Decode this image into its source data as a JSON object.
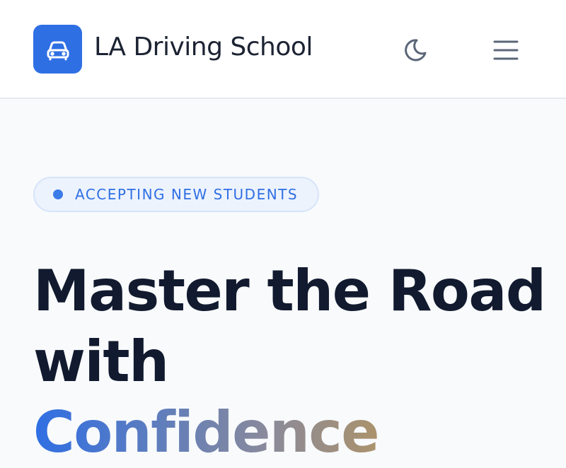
{
  "header": {
    "brand_name": "LA Driving School",
    "logo_icon": "car-icon",
    "theme_toggle_icon": "moon-icon",
    "menu_icon": "hamburger-menu-icon",
    "accent_color": "#2f6fe4"
  },
  "hero": {
    "badge_text": "ACCEPTING NEW STUDENTS",
    "headline": {
      "line1": "Master the Road",
      "line2": "with",
      "line3": "Confidence"
    },
    "gradient_colors": [
      "#2f6fe4",
      "#8a8a9a",
      "#e0a020"
    ]
  }
}
